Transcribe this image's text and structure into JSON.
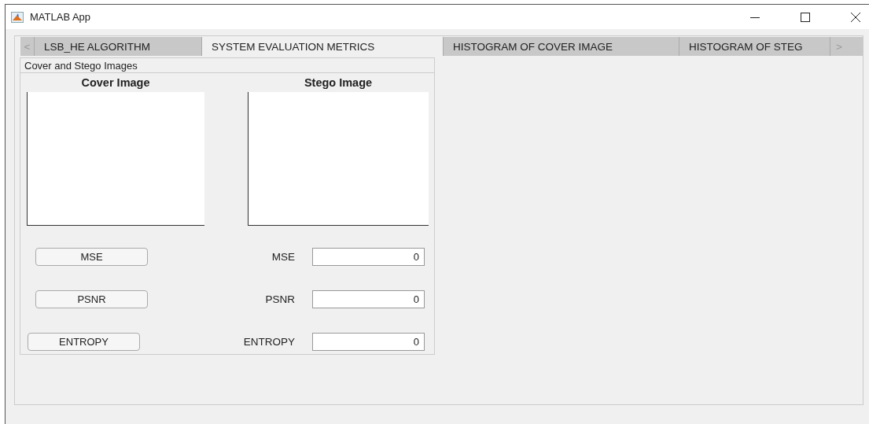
{
  "window": {
    "title": "MATLAB App"
  },
  "tab_scroll": {
    "left": "<",
    "right": ">"
  },
  "tabs": [
    {
      "label": "LSB_HE ALGORITHM",
      "selected": false
    },
    {
      "label": "SYSTEM EVALUATION METRICS",
      "selected": true
    },
    {
      "label": "HISTOGRAM OF COVER IMAGE",
      "selected": false
    },
    {
      "label": "HISTOGRAM OF STEG",
      "selected": false
    }
  ],
  "panel": {
    "title": "Cover and Stego Images",
    "axes": [
      {
        "title": "Cover Image"
      },
      {
        "title": "Stego Image"
      }
    ],
    "metrics": [
      {
        "button": "MSE",
        "label": "MSE",
        "value": "0"
      },
      {
        "button": "PSNR",
        "label": "PSNR",
        "value": "0"
      },
      {
        "button": "ENTROPY",
        "label": "ENTROPY",
        "value": "0"
      }
    ]
  }
}
